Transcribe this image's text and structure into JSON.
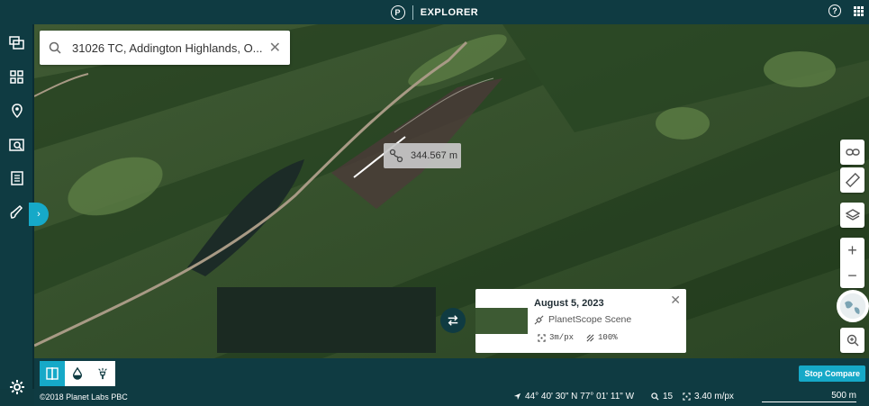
{
  "header": {
    "logo": "P",
    "title": "EXPLORER"
  },
  "search": {
    "value": "31026 TC, Addington Highlands, O..."
  },
  "measure": {
    "distance": "344.567 m"
  },
  "scene": {
    "date": "August 5, 2023",
    "type": "PlanetScope Scene",
    "resolution": "3m/px",
    "coverage": "100%"
  },
  "toolbar": {
    "stop_compare": "Stop Compare"
  },
  "status": {
    "copyright": "©2018 Planet Labs PBC",
    "coordinates": "44° 40' 30\" N 77° 01' 11\" W",
    "zoom": "15",
    "resolution": "3.40 m/px",
    "scale": "500 m"
  },
  "colors": {
    "accent": "#16a9c8",
    "bar": "#0f3b42"
  }
}
